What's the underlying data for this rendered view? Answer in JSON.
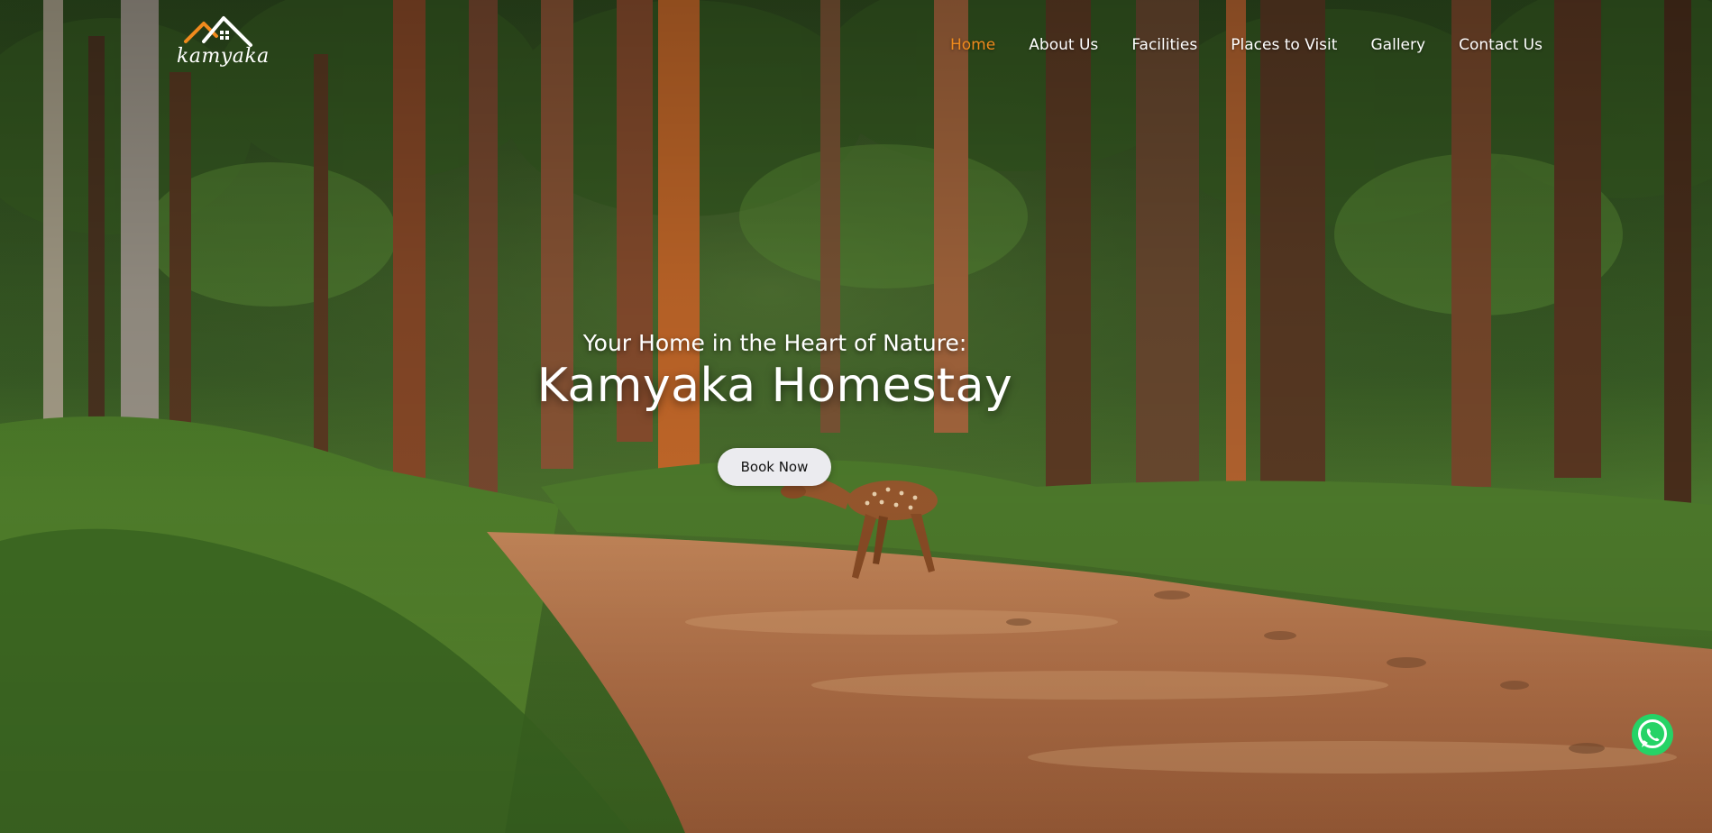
{
  "brand": {
    "logo_text": "kamyaka"
  },
  "nav": {
    "items": [
      {
        "label": "Home",
        "active": true
      },
      {
        "label": "About Us",
        "active": false
      },
      {
        "label": "Facilities",
        "active": false
      },
      {
        "label": "Places to Visit",
        "active": false
      },
      {
        "label": "Gallery",
        "active": false
      },
      {
        "label": "Contact Us",
        "active": false
      }
    ]
  },
  "hero": {
    "tagline": "Your Home in the Heart of Nature:",
    "title": "Kamyaka Homestay",
    "cta_label": "Book Now"
  },
  "floating": {
    "whatsapp_icon": "whatsapp-icon"
  },
  "colors": {
    "accent": "#f08a1d",
    "button_bg": "#ebebef",
    "whatsapp": "#25d366"
  }
}
